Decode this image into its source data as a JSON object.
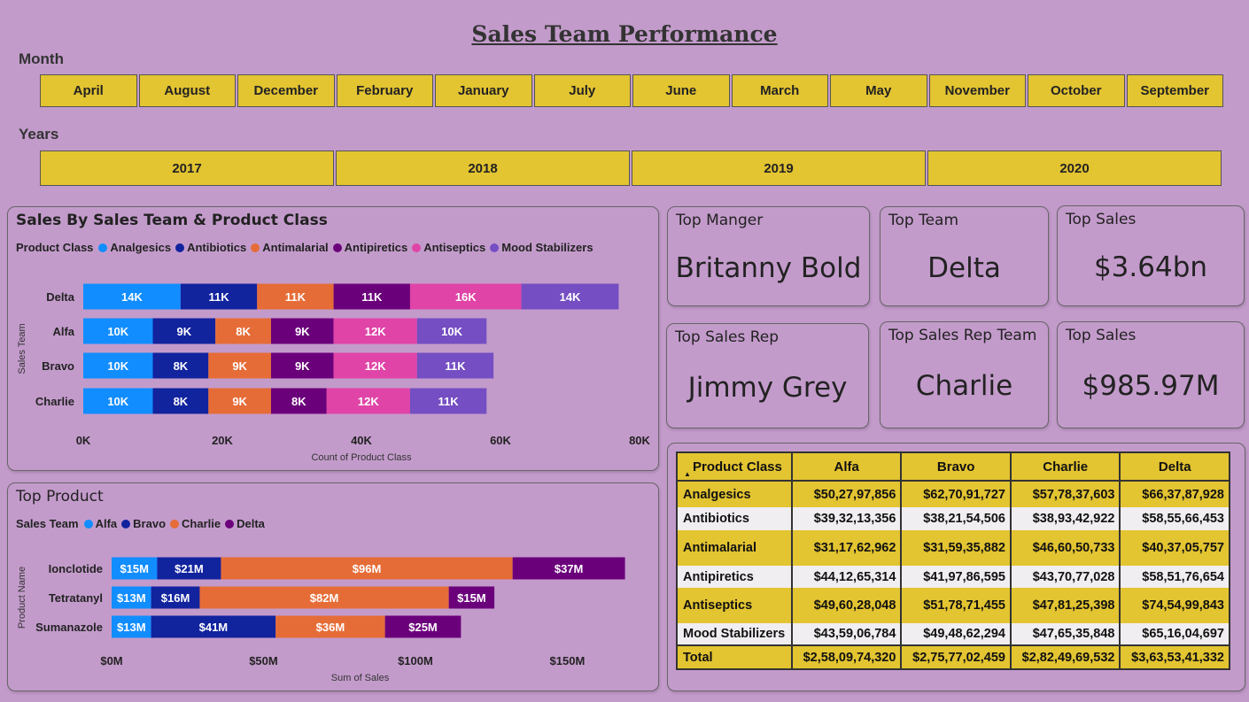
{
  "page_title": "Sales Team Performance",
  "month_slicer": {
    "label": "Month",
    "options": [
      "April",
      "August",
      "December",
      "February",
      "January",
      "July",
      "June",
      "March",
      "May",
      "November",
      "October",
      "September"
    ]
  },
  "year_slicer": {
    "label": "Years",
    "options": [
      "2017",
      "2018",
      "2019",
      "2020"
    ]
  },
  "colors": {
    "background": "#c39bcb",
    "slicer_fill": "#e3c431",
    "Analgesics": "#118dff",
    "Antibiotics": "#12239e",
    "Antimalarial": "#e66c37",
    "Antipiretics": "#6b007b",
    "Antiseptics": "#e044a7",
    "Mood Stabilizers": "#744ec2",
    "Alfa": "#118dff",
    "Bravo": "#12239e",
    "Charlie": "#e66c37",
    "Delta": "#6b007b"
  },
  "kpis": {
    "top_manager": {
      "title": "Top Manger",
      "value": "Britanny Bold"
    },
    "top_team": {
      "title": "Top Team",
      "value": "Delta"
    },
    "top_sales_1": {
      "title": "Top Sales",
      "value": "$3.64bn"
    },
    "top_sales_rep": {
      "title": "Top Sales Rep",
      "value": "Jimmy Grey"
    },
    "top_sales_rep_team": {
      "title": "Top Sales Rep Team",
      "value": "Charlie"
    },
    "top_sales_2": {
      "title": "Top Sales",
      "value": "$985.97M"
    }
  },
  "chart_data": [
    {
      "type": "bar",
      "orientation": "horizontal",
      "stacked": true,
      "title": "Sales By Sales Team & Product Class",
      "legend_title": "Product Class",
      "legend_position": "top-left",
      "categories": [
        "Delta",
        "Alfa",
        "Bravo",
        "Charlie"
      ],
      "series": [
        {
          "name": "Analgesics",
          "values": [
            14000,
            10000,
            10000,
            10000
          ],
          "labels": [
            "14K",
            "10K",
            "10K",
            "10K"
          ]
        },
        {
          "name": "Antibiotics",
          "values": [
            11000,
            9000,
            8000,
            8000
          ],
          "labels": [
            "11K",
            "9K",
            "8K",
            "8K"
          ]
        },
        {
          "name": "Antimalarial",
          "values": [
            11000,
            8000,
            9000,
            9000
          ],
          "labels": [
            "11K",
            "8K",
            "9K",
            "9K"
          ]
        },
        {
          "name": "Antipiretics",
          "values": [
            11000,
            9000,
            9000,
            8000
          ],
          "labels": [
            "11K",
            "9K",
            "9K",
            "8K"
          ]
        },
        {
          "name": "Antiseptics",
          "values": [
            16000,
            12000,
            12000,
            12000
          ],
          "labels": [
            "16K",
            "12K",
            "12K",
            "12K"
          ]
        },
        {
          "name": "Mood Stabilizers",
          "values": [
            14000,
            10000,
            11000,
            11000
          ],
          "labels": [
            "14K",
            "10K",
            "11K",
            "11K"
          ]
        }
      ],
      "xlabel": "Count of Product Class",
      "ylabel": "Sales Team",
      "xlim": [
        0,
        80000
      ],
      "xticks": [
        0,
        20000,
        40000,
        60000,
        80000
      ],
      "xtick_labels": [
        "0K",
        "20K",
        "40K",
        "60K",
        "80K"
      ],
      "grid": false
    },
    {
      "type": "bar",
      "orientation": "horizontal",
      "stacked": true,
      "title": "Top Product",
      "legend_title": "Sales Team",
      "legend_position": "top-left",
      "categories": [
        "Ionclotide",
        "Tetratanyl",
        "Sumanazole"
      ],
      "series": [
        {
          "name": "Alfa",
          "values": [
            15,
            13,
            13
          ],
          "labels": [
            "$15M",
            "$13M",
            "$13M"
          ]
        },
        {
          "name": "Bravo",
          "values": [
            21,
            16,
            41
          ],
          "labels": [
            "$21M",
            "$16M",
            "$41M"
          ]
        },
        {
          "name": "Charlie",
          "values": [
            96,
            82,
            36
          ],
          "labels": [
            "$96M",
            "$82M",
            "$36M"
          ]
        },
        {
          "name": "Delta",
          "values": [
            37,
            15,
            25
          ],
          "labels": [
            "$37M",
            "$15M",
            "$25M"
          ]
        }
      ],
      "xlabel": "Sum of Sales",
      "ylabel": "Product Name",
      "xlim": [
        0,
        170
      ],
      "xticks": [
        0,
        50,
        100,
        150
      ],
      "xtick_labels": [
        "$0M",
        "$50M",
        "$100M",
        "$150M"
      ],
      "grid": false
    }
  ],
  "matrix": {
    "headers": [
      "Product Class",
      "Alfa",
      "Bravo",
      "Charlie",
      "Delta"
    ],
    "rows": [
      [
        "Analgesics",
        "$50,27,97,856",
        "$62,70,91,727",
        "$57,78,37,603",
        "$66,37,87,928"
      ],
      [
        "Antibiotics",
        "$39,32,13,356",
        "$38,21,54,506",
        "$38,93,42,922",
        "$58,55,66,453"
      ],
      [
        "Antimalarial",
        "$31,17,62,962",
        "$31,59,35,882",
        "$46,60,50,733",
        "$40,37,05,757"
      ],
      [
        "Antipiretics",
        "$44,12,65,314",
        "$41,97,86,595",
        "$43,70,77,028",
        "$58,51,76,654"
      ],
      [
        "Antiseptics",
        "$49,60,28,048",
        "$51,78,71,455",
        "$47,81,25,398",
        "$74,54,99,843"
      ],
      [
        "Mood Stabilizers",
        "$43,59,06,784",
        "$49,48,62,294",
        "$47,65,35,848",
        "$65,16,04,697"
      ]
    ],
    "total": [
      "Total",
      "$2,58,09,74,320",
      "$2,75,77,02,459",
      "$2,82,49,69,532",
      "$3,63,53,41,332"
    ]
  }
}
